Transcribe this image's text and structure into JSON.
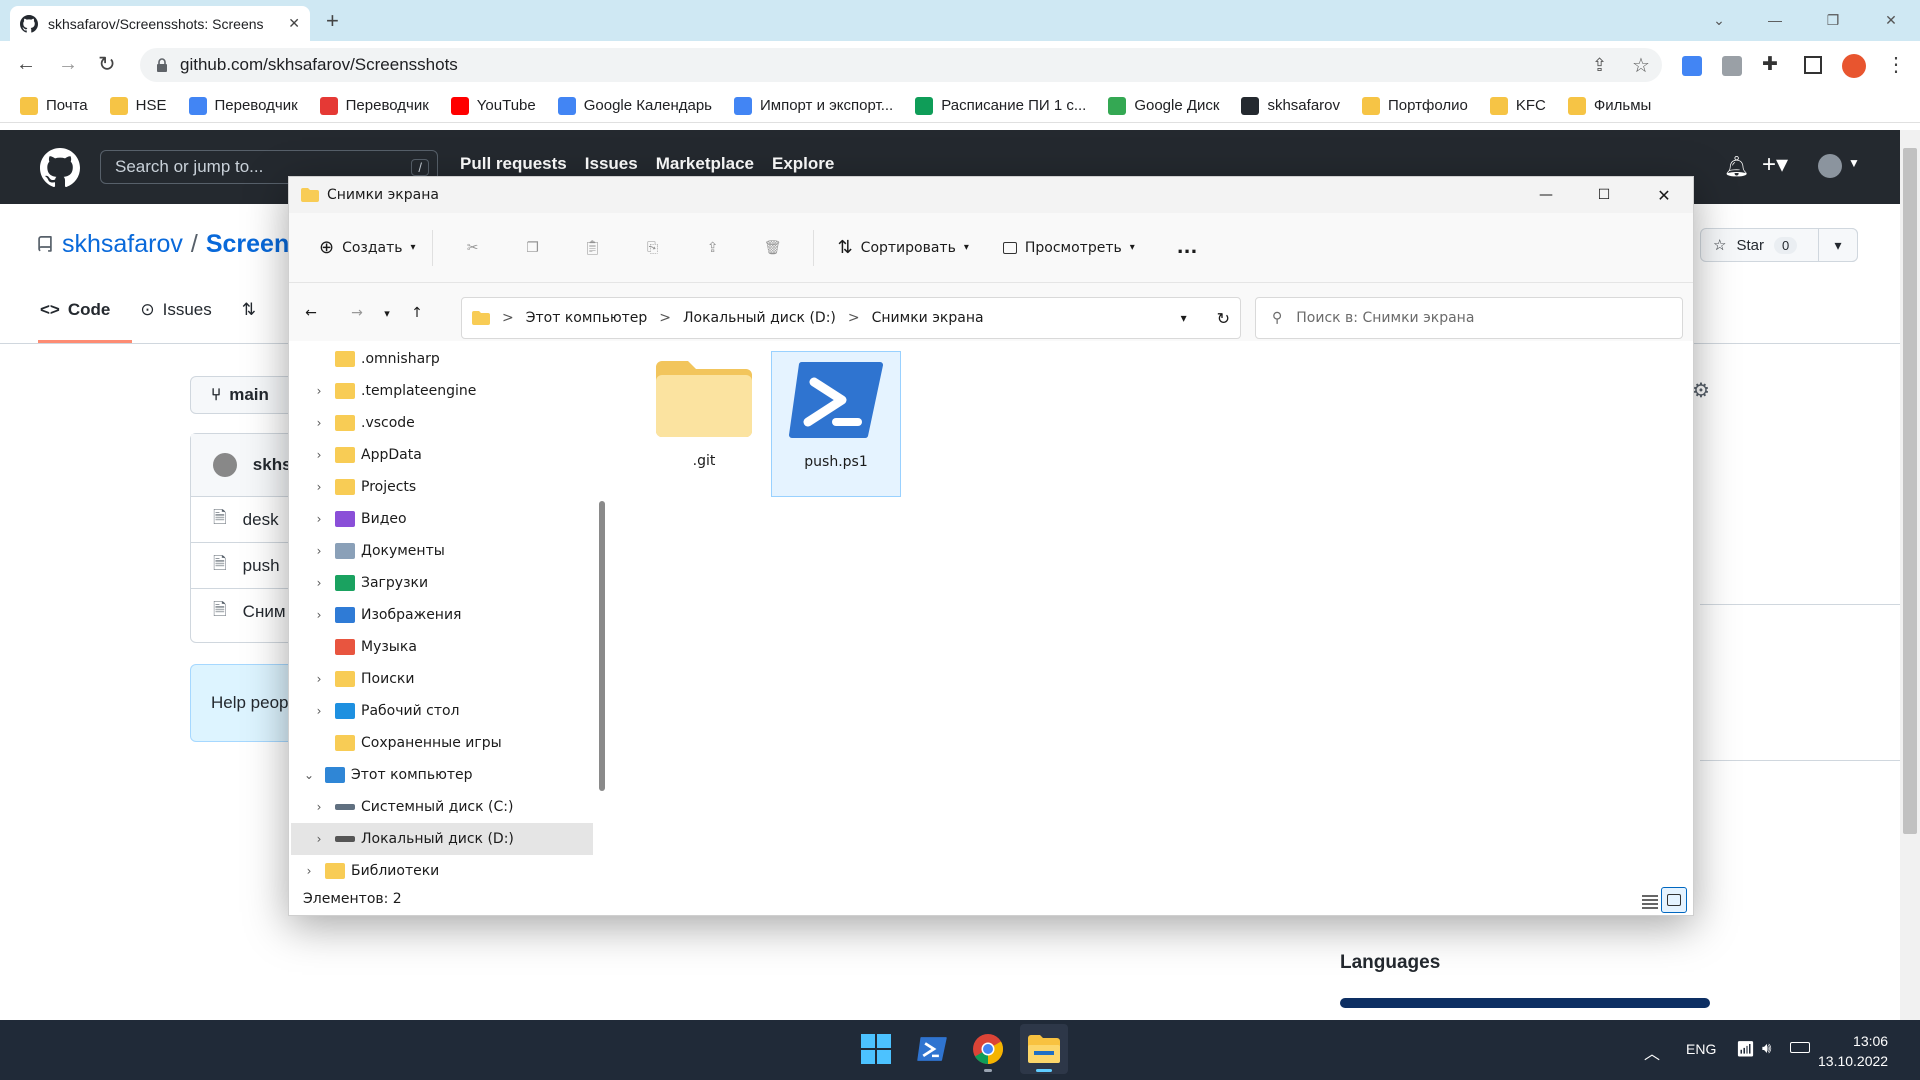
{
  "browser": {
    "tab_title": "skhsafarov/Screensshots: Screens",
    "url": "github.com/skhsafarov/Screensshots",
    "bookmarks": [
      {
        "label": "Почта",
        "icon": "folder-icon",
        "color": "#f6c445"
      },
      {
        "label": "HSE",
        "icon": "folder-icon",
        "color": "#f6c445"
      },
      {
        "label": "Переводчик",
        "icon": "translate-icon",
        "color": "#4285f4"
      },
      {
        "label": "Переводчик",
        "icon": "yandex-translate-icon",
        "color": "#e53935"
      },
      {
        "label": "YouTube",
        "icon": "youtube-icon",
        "color": "#ff0000"
      },
      {
        "label": "Google Календарь",
        "icon": "calendar-icon",
        "color": "#4285f4"
      },
      {
        "label": "Импорт и экспорт...",
        "icon": "calendar-icon",
        "color": "#4285f4"
      },
      {
        "label": "Расписание ПИ 1 с...",
        "icon": "sheets-icon",
        "color": "#0f9d58"
      },
      {
        "label": "Google Диск",
        "icon": "drive-icon",
        "color": "#34a853"
      },
      {
        "label": "skhsafarov",
        "icon": "github-icon",
        "color": "#24292f"
      },
      {
        "label": "Портфолио",
        "icon": "folder-icon",
        "color": "#f6c445"
      },
      {
        "label": "KFC",
        "icon": "folder-icon",
        "color": "#f6c445"
      },
      {
        "label": "Фильмы",
        "icon": "folder-icon",
        "color": "#f6c445"
      }
    ]
  },
  "github": {
    "search_placeholder": "Search or jump to...",
    "search_key": "/",
    "nav": [
      "Pull requests",
      "Issues",
      "Marketplace",
      "Explore"
    ],
    "repo_owner": "skhsafarov",
    "repo_sep": "/",
    "repo_name": "Screens",
    "tabs": {
      "code": "Code",
      "issues": "Issues"
    },
    "branch": "main",
    "commit_user": "skhsa",
    "files": [
      "desk",
      "push",
      "Сним"
    ],
    "help_text": "Help peop",
    "star_label": "Star",
    "star_count": "0",
    "languages_heading": "Languages"
  },
  "explorer": {
    "window_title": "Снимки экрана",
    "commands": {
      "create": "Создать",
      "sort": "Сортировать",
      "view": "Просмотреть",
      "more": "..."
    },
    "breadcrumb": [
      "Этот компьютер",
      "Локальный диск (D:)",
      "Снимки экрана"
    ],
    "breadcrumb_sep": ">",
    "search_placeholder": "Поиск в: Снимки экрана",
    "tree": [
      {
        "label": ".omnisharp",
        "icon": "folder-icon",
        "expandable": false,
        "indent": 1
      },
      {
        "label": ".templateengine",
        "icon": "folder-icon",
        "expandable": true,
        "indent": 1
      },
      {
        "label": ".vscode",
        "icon": "folder-icon",
        "expandable": true,
        "indent": 1
      },
      {
        "label": "AppData",
        "icon": "folder-icon",
        "expandable": true,
        "indent": 1
      },
      {
        "label": "Projects",
        "icon": "folder-icon",
        "expandable": true,
        "indent": 1
      },
      {
        "label": "Видео",
        "icon": "video-folder-icon",
        "expandable": true,
        "indent": 1
      },
      {
        "label": "Документы",
        "icon": "documents-icon",
        "expandable": true,
        "indent": 1
      },
      {
        "label": "Загрузки",
        "icon": "download-icon",
        "expandable": true,
        "indent": 1
      },
      {
        "label": "Изображения",
        "icon": "pictures-icon",
        "expandable": true,
        "indent": 1
      },
      {
        "label": "Музыка",
        "icon": "music-icon",
        "expandable": false,
        "indent": 1
      },
      {
        "label": "Поиски",
        "icon": "folder-icon",
        "expandable": true,
        "indent": 1
      },
      {
        "label": "Рабочий стол",
        "icon": "desktop-icon",
        "expandable": true,
        "indent": 1
      },
      {
        "label": "Сохраненные игры",
        "icon": "folder-icon",
        "expandable": false,
        "indent": 1
      },
      {
        "label": "Этот компьютер",
        "icon": "computer-icon",
        "expandable": true,
        "expanded": true,
        "indent": 0
      },
      {
        "label": "Системный диск (C:)",
        "icon": "system-drive-icon",
        "expandable": true,
        "indent": 1
      },
      {
        "label": "Локальный диск (D:)",
        "icon": "drive-icon",
        "expandable": true,
        "indent": 1,
        "selected": true
      },
      {
        "label": "Библиотеки",
        "icon": "folder-icon",
        "expandable": true,
        "indent": 0
      }
    ],
    "items": [
      {
        "name": ".git",
        "icon": "folder-icon",
        "selected": false
      },
      {
        "name": "push.ps1",
        "icon": "powershell-icon",
        "selected": true
      }
    ],
    "status": "Элементов: 2"
  },
  "taskbar": {
    "apps": [
      "windows-start-icon",
      "powershell-icon",
      "chrome-icon",
      "file-explorer-icon"
    ],
    "lang": "ENG",
    "time": "13:06",
    "date": "13.10.2022"
  }
}
